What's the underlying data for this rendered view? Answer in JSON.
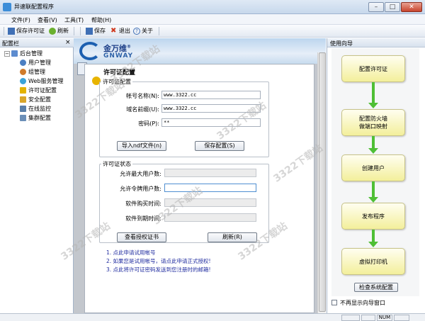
{
  "window": {
    "title": "异速联配置程序",
    "min": "–",
    "max": "□",
    "close": "✕"
  },
  "menu": [
    "文件(F)",
    "查看(V)",
    "工具(T)",
    "帮助(H)"
  ],
  "toolbar": {
    "save_license": "保存许可证",
    "refresh": "刷新",
    "save": "保存",
    "exit": "退出",
    "about": "关于"
  },
  "left_panel": {
    "title": "配置栏",
    "close": "×",
    "root": "后台管理",
    "items": [
      "用户管理",
      "组管理",
      "Web服务管理",
      "许可证配置",
      "安全配置",
      "在线监控",
      "集群配置"
    ]
  },
  "logo": {
    "text": "金万维",
    "sub": "GNWAY",
    "mark": "®"
  },
  "form": {
    "title": "许可证配置",
    "group1": "许可证配置",
    "account_label": "帐号名称(N):",
    "account_value": "www.3322.cc",
    "domain_label": "域名前缀(U):",
    "domain_value": "www.3322.cc",
    "password_label": "密码(P):",
    "password_value": "**",
    "import_btn": "导入ndf文件(n)",
    "save_cfg_btn": "保存配置(S)",
    "group2": "许可证状态",
    "max_users_label": "允许最大用户数:",
    "max_token_label": "允许令牌用户数:",
    "purchase_label": "软件购买时间:",
    "expire_label": "软件到期时间:",
    "view_cert_btn": "查看授权证书",
    "refresh_btn": "刷新(R)",
    "notes": [
      "1. 点此申请试用帐号",
      "2. 如果您是试用帐号，请点此申请正式授权!",
      "3. 点此将许可证密码发送到您注册时的邮箱!"
    ]
  },
  "right_panel": {
    "title": "使用向导",
    "steps": [
      "配置许可证",
      "配置防火墙\n做端口映射",
      "创建用户",
      "发布程序",
      "虚拟打印机"
    ],
    "check_btn": "检查系统配置",
    "checkbox_label": "不再显示向导窗口"
  },
  "statusbar": {
    "num": "NUM"
  },
  "watermark": "3322下载站",
  "colors": {
    "accent": "#1c5fb0",
    "arrow": "#4fbf35",
    "step_fill": "#f3ef9b",
    "note": "#1f2b9f"
  }
}
